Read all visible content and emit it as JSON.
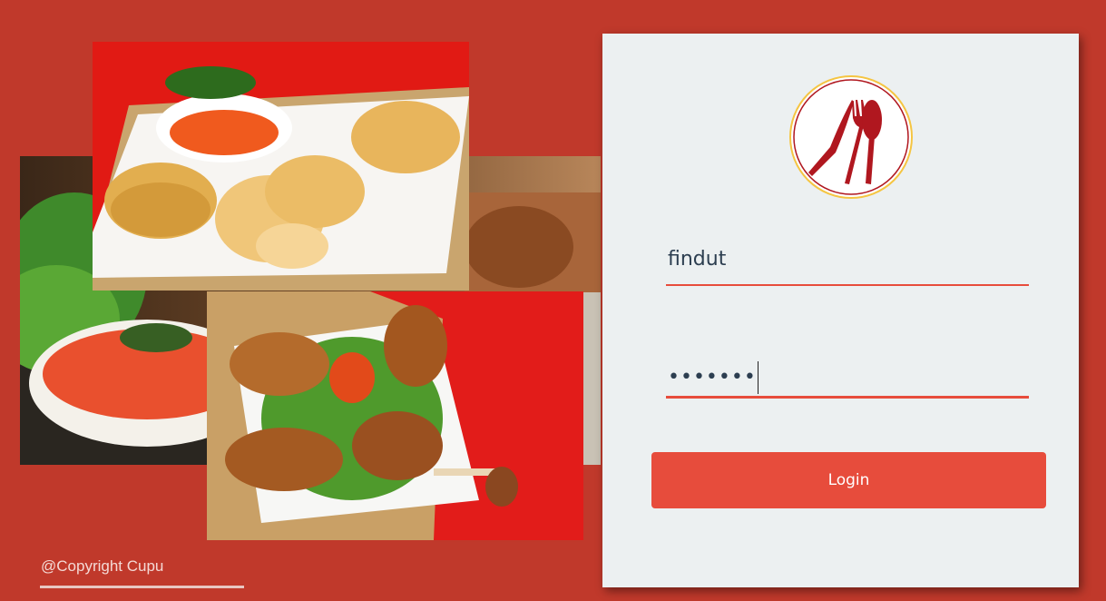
{
  "login": {
    "username_value": "findut",
    "password_masked": "•••••••",
    "button_label": "Login",
    "logo_icon": "fork-knife-spoon-icon"
  },
  "footer": {
    "copyright": "@Copyright Cupu"
  },
  "colors": {
    "background": "#c0392b",
    "card": "#ecf0f1",
    "accent": "#e74c3c",
    "logo_ring": "#f5c542",
    "logo_utensils": "#b0171f"
  }
}
